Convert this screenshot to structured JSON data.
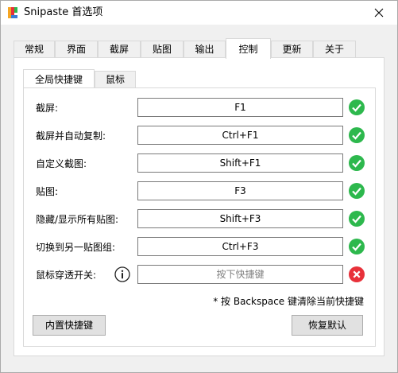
{
  "window": {
    "title": "Snipaste 首选项"
  },
  "outer_tabs": [
    "常规",
    "界面",
    "截屏",
    "贴图",
    "输出",
    "控制",
    "更新",
    "关于"
  ],
  "active_outer_tab": "控制",
  "inner_tabs": [
    "全局快捷键",
    "鼠标"
  ],
  "active_inner_tab": "全局快捷键",
  "shortcuts": [
    {
      "label": "截屏:",
      "value": "F1",
      "status": "ok"
    },
    {
      "label": "截屏并自动复制:",
      "value": "Ctrl+F1",
      "status": "ok"
    },
    {
      "label": "自定义截图:",
      "value": "Shift+F1",
      "status": "ok"
    },
    {
      "label": "贴图:",
      "value": "F3",
      "status": "ok"
    },
    {
      "label": "隐藏/显示所有贴图:",
      "value": "Shift+F3",
      "status": "ok"
    },
    {
      "label": "切换到另一贴图组:",
      "value": "Ctrl+F3",
      "status": "ok"
    },
    {
      "label": "鼠标穿透开关:",
      "placeholder": "按下快捷键",
      "value": "",
      "status": "error"
    }
  ],
  "note": "* 按 Backspace 键清除当前快捷键",
  "buttons": {
    "builtin": "内置快捷键",
    "restore": "恢复默认"
  },
  "colors": {
    "ok": "#2db84d",
    "error": "#e8313a",
    "panel": "#ffffff",
    "chrome": "#f0f0f0"
  }
}
